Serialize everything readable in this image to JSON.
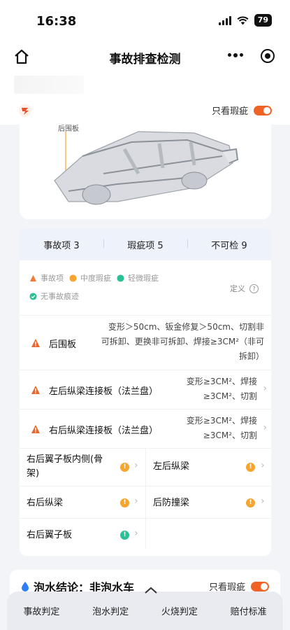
{
  "status": {
    "time": "16:38",
    "battery": "79"
  },
  "nav": {
    "title": "事故排查检测",
    "home_icon": "home-icon",
    "more_icon": "more-icon",
    "target_icon": "target-icon"
  },
  "header": {
    "only_defect_label": "只看瑕疵",
    "toggle_on": true
  },
  "car": {
    "label": "后围板"
  },
  "tabs": [
    {
      "label": "事故项 3"
    },
    {
      "label": "瑕疵项 5"
    },
    {
      "label": "不可检 9"
    }
  ],
  "legend": {
    "items": [
      {
        "label": "事故项",
        "color": "#f47a3a"
      },
      {
        "label": "中度瑕疵",
        "color": "#f6a531"
      },
      {
        "label": "轻微瑕疵",
        "color": "#2bbf96"
      },
      {
        "label": "无事故痕迹",
        "color": "#2bbf96"
      }
    ],
    "define_label": "定义",
    "define_icon": "?"
  },
  "accident_rows": [
    {
      "name": "后围板",
      "desc_lines": [
        "变形＞50cm、钣金修复＞50cm、切割非",
        "可拆卸、更换非可拆卸、焊接≥3CM²（非可",
        "拆卸）"
      ]
    },
    {
      "name": "左后纵梁连接板（法兰盘）",
      "desc_lines": [
        "变形≥3CM²、焊接",
        "≥3CM²、切割"
      ]
    },
    {
      "name": "右后纵梁连接板（法兰盘）",
      "desc_lines": [
        "变形≥3CM²、焊接",
        "≥3CM²、切割"
      ]
    }
  ],
  "defect_grid": [
    {
      "left": {
        "label_lines": [
          "右后翼子板内侧(骨",
          "架)"
        ],
        "level": "moderate"
      },
      "right": {
        "label_lines": [
          "左后纵梁"
        ],
        "level": "moderate"
      }
    },
    {
      "left": {
        "label_lines": [
          "右后纵梁"
        ],
        "level": "moderate"
      },
      "right": {
        "label_lines": [
          "后防撞梁"
        ],
        "level": "moderate"
      }
    },
    {
      "left": {
        "label_lines": [
          "右后翼子板"
        ],
        "level": "minor"
      }
    }
  ],
  "soak": {
    "title": "泡水结论：非泡水车",
    "only_defect_label": "只看瑕疵"
  },
  "bottom_tabs": [
    {
      "label": "事故判定"
    },
    {
      "label": "泡水判定"
    },
    {
      "label": "火烧判定"
    },
    {
      "label": "赔付标准"
    }
  ]
}
